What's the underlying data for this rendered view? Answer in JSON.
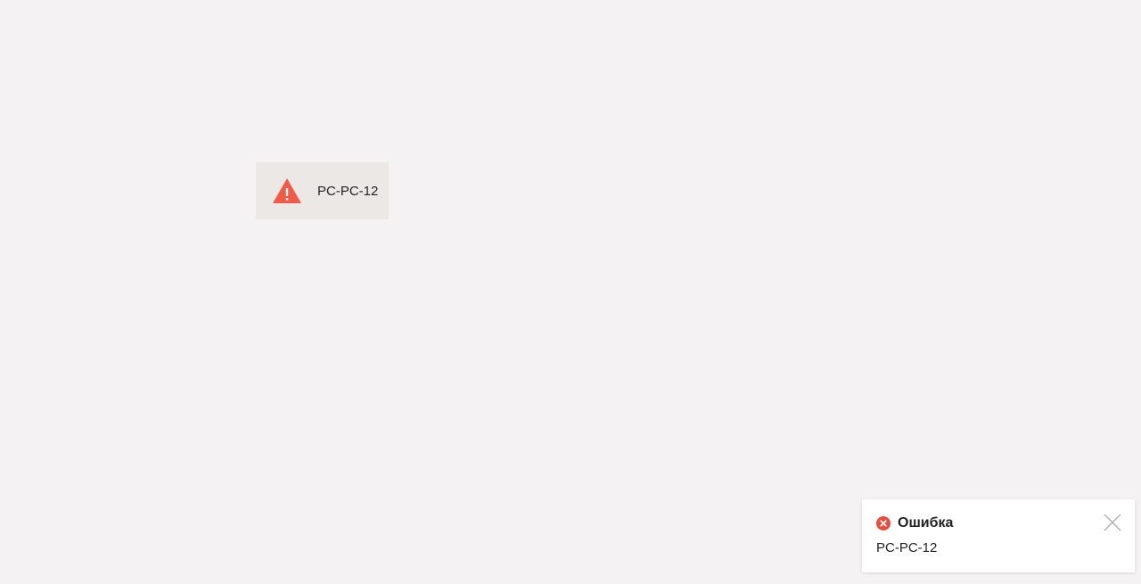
{
  "device": {
    "label": "PC-PC-12",
    "status_icon": "warning-triangle-icon",
    "status_color": "#f25a47"
  },
  "notification": {
    "type": "error",
    "icon": "error-circle-icon",
    "icon_color": "#e74c3c",
    "title": "Ошибка",
    "message": "PC-PC-12",
    "close_icon": "close-icon"
  },
  "colors": {
    "background": "#f4f2f2",
    "chip_background": "#ebe8e6",
    "toast_background": "#ffffff"
  }
}
